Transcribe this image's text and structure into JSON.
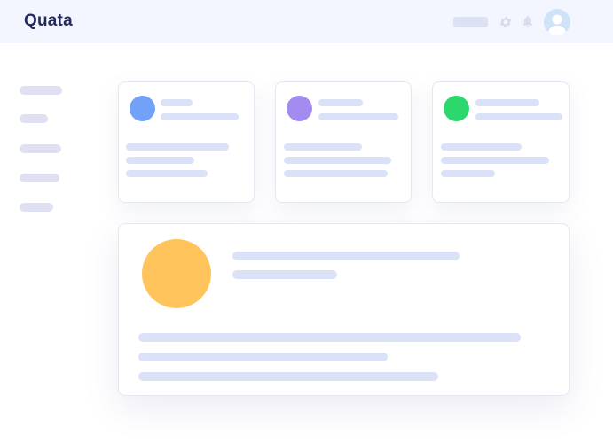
{
  "header": {
    "brand": "Quata"
  },
  "icons": {
    "settings": "gear-icon",
    "notifications": "bell-icon",
    "profile": "avatar"
  },
  "colors": {
    "header_bg": "#f3f6fe",
    "brand_text": "#252a5e",
    "placeholder": "#dbe2f7",
    "card1_accent": "#74a1f8",
    "card2_accent": "#a38bf0",
    "card3_accent": "#2cd86d",
    "main_accent": "#ffc45c"
  }
}
